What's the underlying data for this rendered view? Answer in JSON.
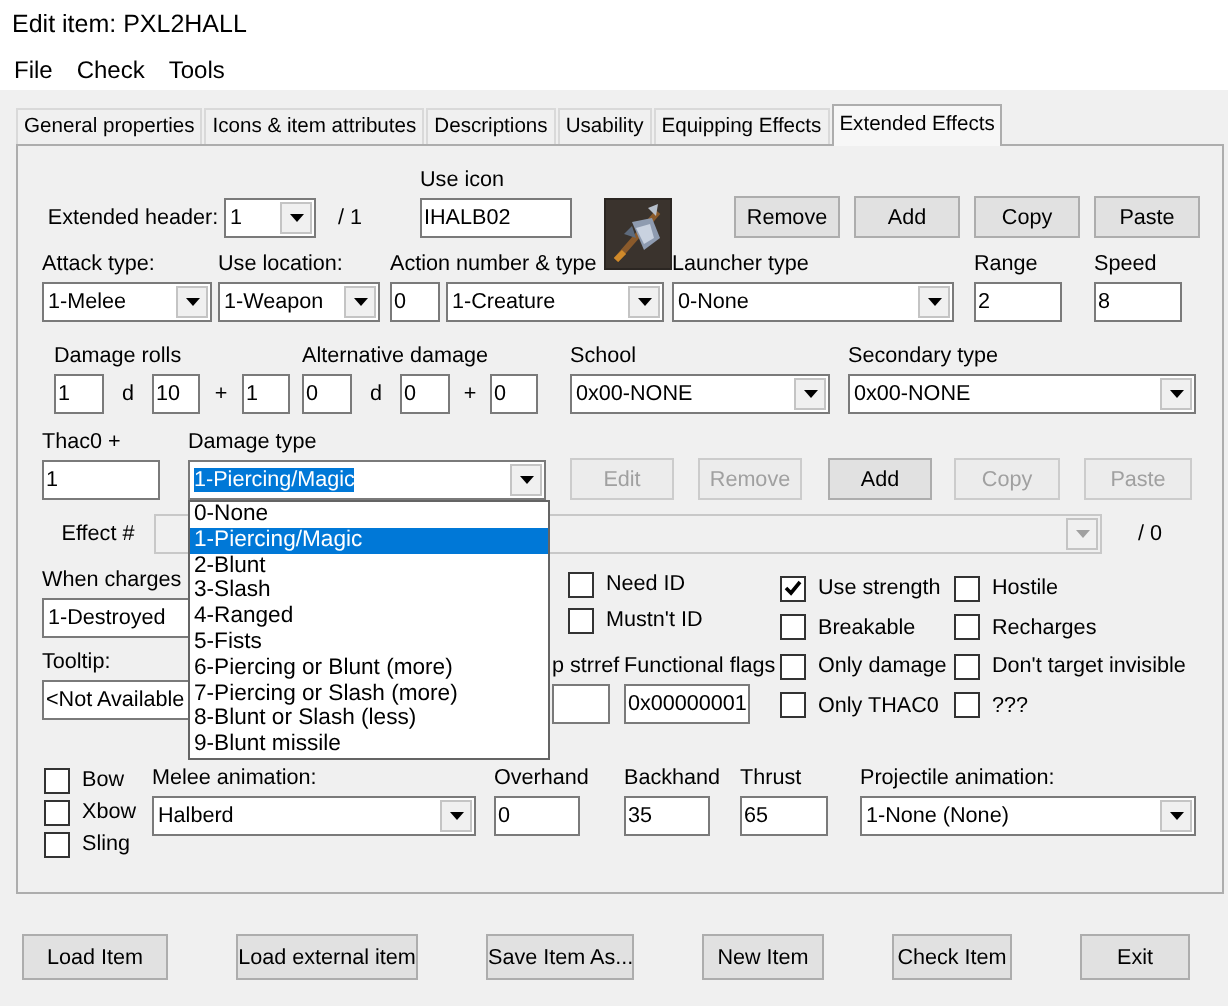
{
  "window": {
    "title": "Edit item: PXL2HALL"
  },
  "menu": [
    {
      "label": "File"
    },
    {
      "label": "Check"
    },
    {
      "label": "Tools"
    }
  ],
  "tabs": [
    {
      "label": "General properties",
      "selected": false
    },
    {
      "label": "Icons & item attributes",
      "selected": false
    },
    {
      "label": "Descriptions",
      "selected": false
    },
    {
      "label": "Usability",
      "selected": false
    },
    {
      "label": "Equipping Effects",
      "selected": false
    },
    {
      "label": "Extended Effects",
      "selected": true
    }
  ],
  "header_row": [
    {
      "kind": "text",
      "text": "Extended header:"
    },
    {
      "kind": "combo",
      "value": "1"
    },
    {
      "kind": "text",
      "text": "/ 1"
    },
    {
      "kind": "field",
      "label": "Use icon",
      "value": "IHALB02"
    },
    {
      "kind": "picture"
    },
    {
      "kind": "button",
      "label": "Remove",
      "disabled": false
    },
    {
      "kind": "button",
      "label": "Add",
      "disabled": false
    },
    {
      "kind": "button",
      "label": "Copy",
      "disabled": false
    },
    {
      "kind": "button",
      "label": "Paste",
      "disabled": false
    }
  ],
  "attack_row": [
    {
      "kind": "combo",
      "label": "Attack type:",
      "value": "1-Melee"
    },
    {
      "kind": "combo",
      "label": "Use location:",
      "value": "1-Weapon"
    },
    {
      "kind": "field",
      "label": "Action number & type",
      "value": "0"
    },
    {
      "kind": "combo",
      "value": "1-Creature"
    },
    {
      "kind": "combo",
      "label": "Launcher type",
      "value": "0-None"
    },
    {
      "kind": "field",
      "label": "Range",
      "value": "2"
    },
    {
      "kind": "field",
      "label": "Speed",
      "value": "8"
    }
  ],
  "damage_row": [
    {
      "kind": "field",
      "label": "Damage rolls",
      "value": "1"
    },
    {
      "kind": "text",
      "text": "d"
    },
    {
      "kind": "field",
      "value": "10"
    },
    {
      "kind": "text",
      "text": "+"
    },
    {
      "kind": "field",
      "value": "1"
    },
    {
      "kind": "field",
      "label": "Alternative damage",
      "value": "0"
    },
    {
      "kind": "text",
      "text": "d"
    },
    {
      "kind": "field",
      "value": "0"
    },
    {
      "kind": "text",
      "text": "+"
    },
    {
      "kind": "field",
      "value": "0"
    },
    {
      "kind": "combo",
      "label": "School",
      "value": "0x00-NONE"
    },
    {
      "kind": "combo",
      "label": "Secondary type",
      "value": "0x00-NONE"
    }
  ],
  "thac0_row": [
    {
      "kind": "field",
      "label": "Thac0 +",
      "value": "1"
    },
    {
      "kind": "combo",
      "label": "Damage type",
      "value": "1-Piercing/Magic",
      "focused": true
    },
    {
      "kind": "button",
      "label": "Edit",
      "disabled": true
    },
    {
      "kind": "button",
      "label": "Remove",
      "disabled": true
    },
    {
      "kind": "button",
      "label": "Add",
      "disabled": false
    },
    {
      "kind": "button",
      "label": "Copy",
      "disabled": true
    },
    {
      "kind": "button",
      "label": "Paste",
      "disabled": true
    }
  ],
  "effect_row": [
    {
      "kind": "text",
      "text": "Effect #"
    },
    {
      "kind": "combo",
      "disabled": true
    },
    {
      "kind": "text",
      "text": "/ 0"
    }
  ],
  "charges": {
    "label": "When charges",
    "value": "1-Destroyed"
  },
  "tooltip": {
    "label": "Tooltip:",
    "value": "<Not Available"
  },
  "id_flags": [
    {
      "label": "Need ID",
      "checked": false
    },
    {
      "label": "Mustn't ID",
      "checked": false
    }
  ],
  "strref": {
    "label": "p strref"
  },
  "functional_flags": {
    "label": "Functional flags",
    "value": "0x00000001"
  },
  "flags": [
    {
      "label": "Use strength",
      "checked": true
    },
    {
      "label": "Hostile",
      "checked": false
    },
    {
      "label": "Breakable",
      "checked": false
    },
    {
      "label": "Recharges",
      "checked": false
    },
    {
      "label": "Only damage",
      "checked": false
    },
    {
      "label": "Don't target invisible",
      "checked": false
    },
    {
      "label": "Only THAC0",
      "checked": false
    },
    {
      "label": "???",
      "checked": false
    }
  ],
  "launchers": [
    {
      "label": "Bow",
      "checked": false
    },
    {
      "label": "Xbow",
      "checked": false
    },
    {
      "label": "Sling",
      "checked": false
    }
  ],
  "animation_row": [
    {
      "kind": "combo",
      "label": "Melee animation:",
      "value": "Halberd"
    },
    {
      "kind": "field",
      "label": "Overhand",
      "value": "0"
    },
    {
      "kind": "field",
      "label": "Backhand",
      "value": "35"
    },
    {
      "kind": "field",
      "label": "Thrust",
      "value": "65"
    },
    {
      "kind": "combo",
      "label": "Projectile animation:",
      "value": "1-None (None)"
    }
  ],
  "damage_type_list": [
    {
      "label": "0-None",
      "selected": false
    },
    {
      "label": "1-Piercing/Magic",
      "selected": true
    },
    {
      "label": "2-Blunt",
      "selected": false
    },
    {
      "label": "3-Slash",
      "selected": false
    },
    {
      "label": "4-Ranged",
      "selected": false
    },
    {
      "label": "5-Fists",
      "selected": false
    },
    {
      "label": "6-Piercing or Blunt (more)",
      "selected": false
    },
    {
      "label": "7-Piercing or Slash (more)",
      "selected": false
    },
    {
      "label": "8-Blunt or Slash (less)",
      "selected": false
    },
    {
      "label": "9-Blunt missile",
      "selected": false
    }
  ],
  "footer_buttons": [
    {
      "label": "Load Item"
    },
    {
      "label": "Load external item"
    },
    {
      "label": "Save Item As..."
    },
    {
      "label": "New Item"
    },
    {
      "label": "Check Item"
    },
    {
      "label": "Exit"
    }
  ]
}
